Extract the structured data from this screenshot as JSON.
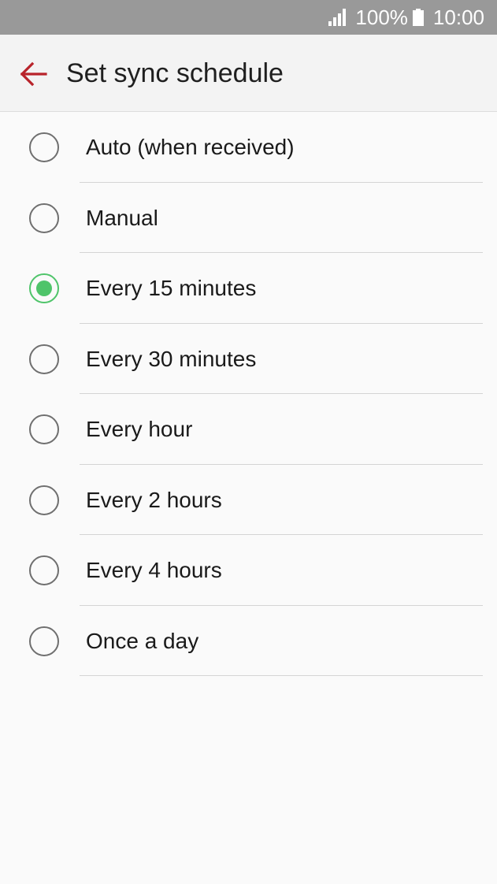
{
  "status_bar": {
    "icons": [
      "signal-icon",
      "battery-icon"
    ],
    "battery_percent": "100%",
    "time": "10:00"
  },
  "header": {
    "back_icon": "arrow-left-icon",
    "title": "Set sync schedule"
  },
  "options": [
    {
      "label": "Auto (when received)",
      "selected": false
    },
    {
      "label": "Manual",
      "selected": false
    },
    {
      "label": "Every 15 minutes",
      "selected": true
    },
    {
      "label": "Every 30 minutes",
      "selected": false
    },
    {
      "label": "Every hour",
      "selected": false
    },
    {
      "label": "Every 2 hours",
      "selected": false
    },
    {
      "label": "Every 4 hours",
      "selected": false
    },
    {
      "label": "Once a day",
      "selected": false
    }
  ],
  "colors": {
    "status_bar_bg": "#999999",
    "app_bar_bg": "#f3f3f3",
    "accent_back_arrow": "#b8232a",
    "radio_selected": "#4fc46a",
    "radio_unselected": "#6f6f6f",
    "page_bg": "#fafafa"
  }
}
